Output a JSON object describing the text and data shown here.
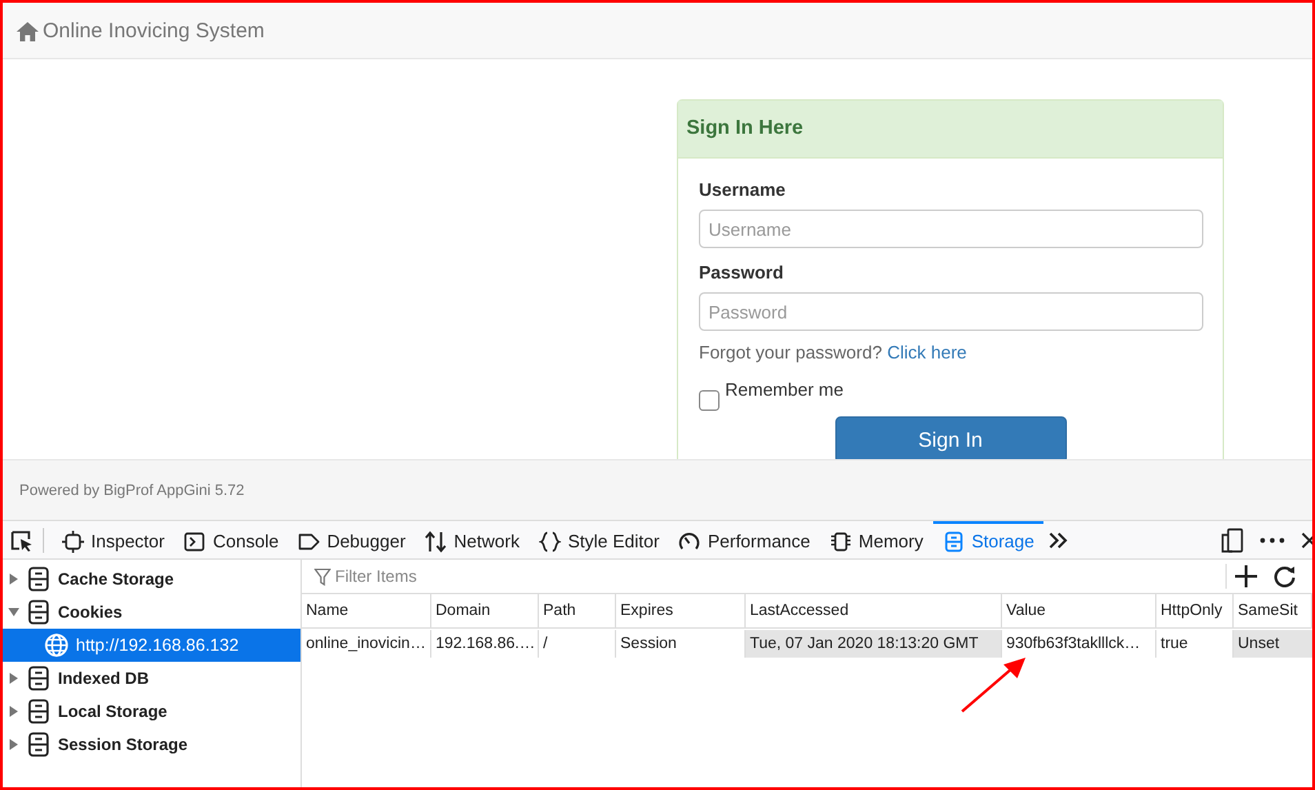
{
  "navbar": {
    "title": "Online Inovicing System"
  },
  "login": {
    "heading": "Sign In Here",
    "fields": [
      {
        "label": "Username",
        "placeholder": "Username"
      },
      {
        "label": "Password",
        "placeholder": "Password"
      }
    ],
    "forgot_text": "Forgot your password?",
    "forgot_link": "Click here",
    "remember": {
      "label": "Remember me",
      "checked": false
    },
    "button": "Sign In"
  },
  "footer": "Powered by BigProf AppGini 5.72",
  "devtools": {
    "tabs": [
      {
        "label": "Inspector",
        "selected": false
      },
      {
        "label": "Console",
        "selected": false
      },
      {
        "label": "Debugger",
        "selected": false
      },
      {
        "label": "Network",
        "selected": false
      },
      {
        "label": "Style Editor",
        "selected": false
      },
      {
        "label": "Performance",
        "selected": false
      },
      {
        "label": "Memory",
        "selected": false
      },
      {
        "label": "Storage",
        "selected": true
      }
    ],
    "sidebar": [
      {
        "label": "Cache Storage",
        "expanded": false
      },
      {
        "label": "Cookies",
        "expanded": true,
        "children": [
          {
            "label": "http://192.168.86.132",
            "selected": true
          }
        ]
      },
      {
        "label": "Indexed DB",
        "expanded": false
      },
      {
        "label": "Local Storage",
        "expanded": false
      },
      {
        "label": "Session Storage",
        "expanded": false
      }
    ],
    "filter": {
      "placeholder": "Filter Items"
    },
    "table": {
      "columns": [
        "Name",
        "Domain",
        "Path",
        "Expires",
        "LastAccessed",
        "Value",
        "HttpOnly",
        "SameSit"
      ],
      "rows": [
        [
          {
            "text": "online_inovicin…",
            "shaded": false
          },
          {
            "text": "192.168.86.…",
            "shaded": false
          },
          {
            "text": "/",
            "shaded": false
          },
          {
            "text": "Session",
            "shaded": false
          },
          {
            "text": "Tue, 07 Jan 2020 18:13:20 GMT",
            "shaded": true
          },
          {
            "text": "930fb63f3taklllck…",
            "shaded": false
          },
          {
            "text": "true",
            "shaded": false
          },
          {
            "text": "Unset",
            "shaded": true
          }
        ]
      ]
    }
  }
}
